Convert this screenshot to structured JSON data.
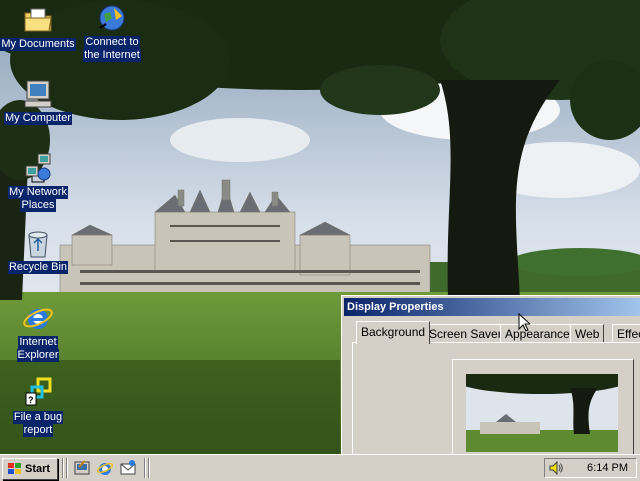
{
  "desktop": {
    "icons": [
      {
        "label_line1": "My Documents",
        "label_line2": "",
        "icon": "my-documents-icon"
      },
      {
        "label_line1": "Connect to",
        "label_line2": "the Internet",
        "icon": "connect-internet-icon"
      },
      {
        "label_line1": "My Computer",
        "label_line2": "",
        "icon": "my-computer-icon"
      },
      {
        "label_line1": "My Network",
        "label_line2": "Places",
        "icon": "network-places-icon"
      },
      {
        "label_line1": "Recycle Bin",
        "label_line2": "",
        "icon": "recycle-bin-icon"
      },
      {
        "label_line1": "Internet",
        "label_line2": "Explorer",
        "icon": "internet-explorer-icon"
      },
      {
        "label_line1": "File a bug",
        "label_line2": "report",
        "icon": "bug-report-icon"
      }
    ]
  },
  "window": {
    "title": "Display Properties",
    "tabs": [
      "Background",
      "Screen Saver",
      "Appearance",
      "Web",
      "Effec"
    ],
    "active_tab": "Background"
  },
  "taskbar": {
    "start_label": "Start",
    "quick_launch": [
      "show-desktop-icon",
      "internet-explorer-icon",
      "outlook-express-icon"
    ],
    "tray_icon": "volume-icon",
    "clock": "6:14 PM"
  },
  "colors": {
    "selection": "#0a246a",
    "title_gradient_start": "#0a246a",
    "title_gradient_end": "#a6caf0",
    "face": "#d4d0c8"
  }
}
